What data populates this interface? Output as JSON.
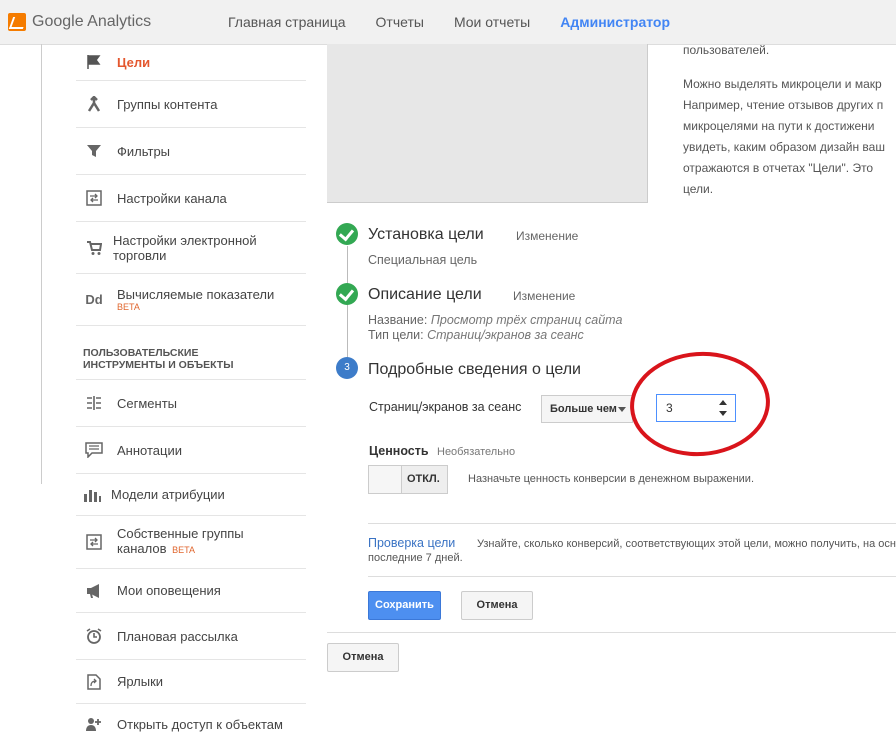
{
  "app": {
    "logo_text": "Google Analytics"
  },
  "nav": {
    "items": [
      "Главная страница",
      "Отчеты",
      "Мои отчеты",
      "Администратор"
    ]
  },
  "sidebar": {
    "items": [
      {
        "label": "Цели",
        "icon": "flag-icon"
      },
      {
        "label": "Группы контента",
        "icon": "content-groups-icon"
      },
      {
        "label": "Фильтры",
        "icon": "filter-icon"
      },
      {
        "label": "Настройки канала",
        "icon": "channel-settings-icon"
      },
      {
        "label": "Настройки электронной торговли",
        "icon": "cart-icon"
      },
      {
        "label": "Вычисляемые показатели",
        "beta": "BETA",
        "icon": "dd-icon"
      },
      {
        "label": "Сегменты",
        "icon": "segments-icon"
      },
      {
        "label": "Аннотации",
        "icon": "annotation-icon"
      },
      {
        "label": "Модели атрибуции",
        "icon": "attribution-icon"
      },
      {
        "label": "Собственные группы каналов",
        "beta": "BETA",
        "icon": "custom-channels-icon"
      },
      {
        "label": "Мои оповещения",
        "icon": "megaphone-icon"
      },
      {
        "label": "Плановая рассылка",
        "icon": "clock-icon"
      },
      {
        "label": "Ярлыки",
        "icon": "shortcut-icon"
      },
      {
        "label": "Открыть доступ к объектам",
        "icon": "share-icon"
      }
    ],
    "section_title": "ПОЛЬЗОВАТЕЛЬСКИЕ ИНСТРУМЕНТЫ И ОБЪЕКТЫ"
  },
  "info": {
    "lines": [
      "пользователей.",
      "Можно выделять микроцели и макр",
      "Например, чтение отзывов других п",
      "микроцелями на пути к достижени",
      "увидеть, каким образом дизайн ваш",
      "отражаются в отчетах \"Цели\". Это",
      "цели."
    ]
  },
  "steps": {
    "step1": {
      "title": "Установка цели",
      "link": "Изменение",
      "sub": "Специальная цель"
    },
    "step2": {
      "title": "Описание цели",
      "link": "Изменение",
      "name_label": "Название:",
      "name_value": "Просмотр трёх страниц сайта",
      "type_label": "Тип цели:",
      "type_value": "Страниц/экранов за сеанс"
    },
    "step3": {
      "number": "3",
      "title": "Подробные сведения о цели"
    }
  },
  "details": {
    "field_label": "Страниц/экранов за сеанс",
    "comparator": "Больше чем",
    "value": "3",
    "value_title": "Ценность",
    "value_optional": "Необязательно",
    "toggle_state": "ОТКЛ.",
    "toggle_desc": "Назначьте ценность конверсии в денежном выражении.",
    "verify_link": "Проверка цели",
    "verify_desc": "Узнайте, сколько конверсий, соответствующих этой цели, можно получить, на осн",
    "verify_desc2": "последние 7 дней.",
    "save": "Сохранить",
    "cancel": "Отмена",
    "cancel_outer": "Отмена"
  },
  "colors": {
    "accent": "#4285f4",
    "active_sidebar": "#e4572e",
    "check": "#33a853",
    "oval": "#d9141b"
  }
}
